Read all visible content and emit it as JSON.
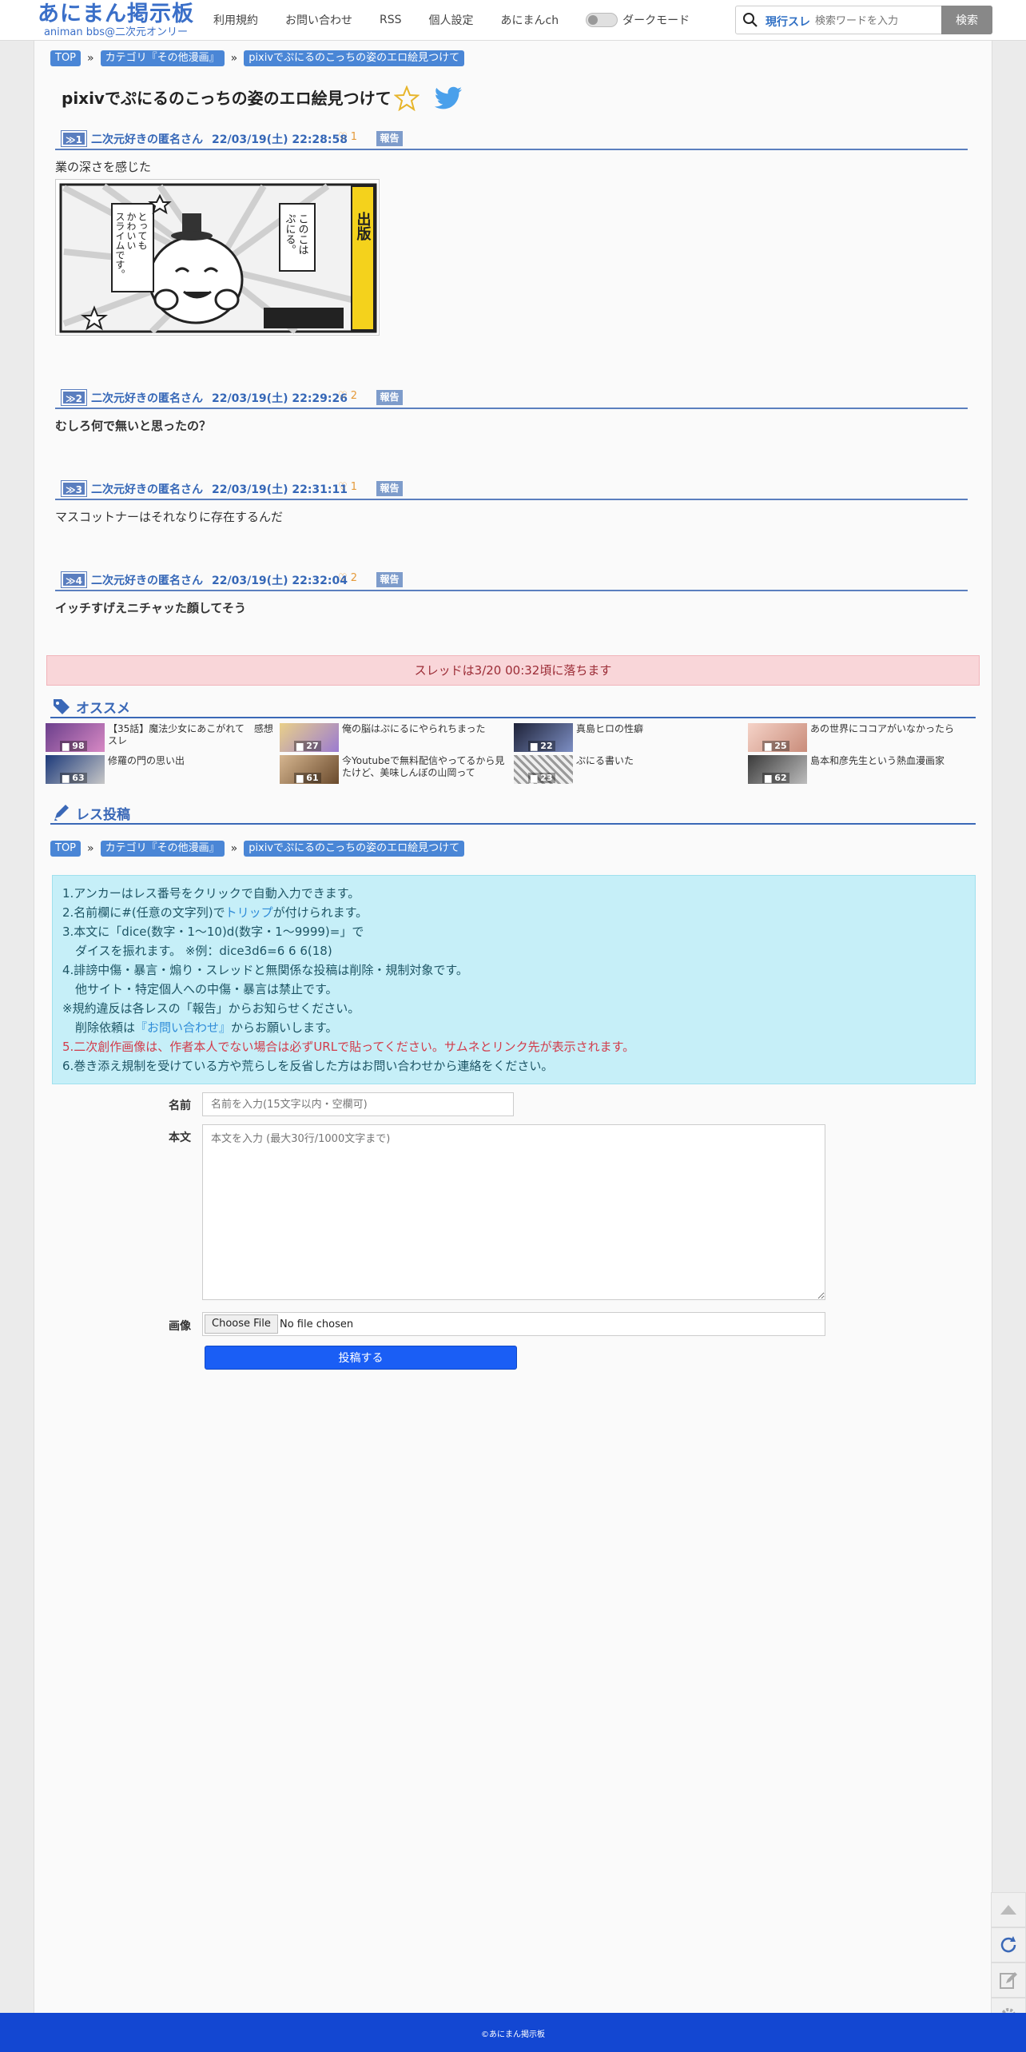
{
  "site": {
    "logo_main": "あにまん掲示板",
    "logo_sub": "animan bbs@二次元オンリー"
  },
  "nav": {
    "terms": "利用規約",
    "contact": "お問い合わせ",
    "rss": "RSS",
    "settings": "個人設定",
    "animanch": "あにまんch",
    "dark_mode": "ダークモード"
  },
  "search": {
    "scope": "現行スレ",
    "placeholder": "検索ワードを入力",
    "button": "検索"
  },
  "breadcrumb": [
    "TOP",
    "カテゴリ『その他漫画』",
    "pixivでぷにるのこっちの姿のエロ絵見つけて"
  ],
  "breadcrumb_sep": "»",
  "thread": {
    "title": "pixivでぷにるのこっちの姿のエロ絵見つけて"
  },
  "posts": [
    {
      "anchor": "≫1",
      "author": "二次元好きの匿名さん",
      "date": "22/03/19(土) 22:28:58",
      "likes": "1",
      "report": "報告",
      "body": "業の深さを感じた",
      "bold": false,
      "image_text": [
        "このこは",
        "ぷにる。",
        "とっても",
        "かわいい",
        "スライムです。",
        "出版"
      ]
    },
    {
      "anchor": "≫2",
      "author": "二次元好きの匿名さん",
      "date": "22/03/19(土) 22:29:26",
      "likes": "2",
      "report": "報告",
      "body": "むしろ何で無いと思ったの？",
      "bold": true
    },
    {
      "anchor": "≫3",
      "author": "二次元好きの匿名さん",
      "date": "22/03/19(土) 22:31:11",
      "likes": "1",
      "report": "報告",
      "body": "マスコットナーはそれなりに存在するんだ",
      "bold": false
    },
    {
      "anchor": "≫4",
      "author": "二次元好きの匿名さん",
      "date": "22/03/19(土) 22:32:04",
      "likes": "2",
      "report": "報告",
      "body": "イッチすげえニチャッた顔してそう",
      "bold": true
    }
  ],
  "drop_notice": "スレッドは3/20 00:32頃に落ちます",
  "recommend": {
    "heading": "オススメ",
    "items": [
      {
        "title": "【35話】魔法少女にあこがれて　感想スレ",
        "count": "98",
        "color": "#8a5aa8"
      },
      {
        "title": "俺の脳はぷにるにやられちまった",
        "count": "27",
        "color": "#c9a24a"
      },
      {
        "title": "真島ヒロの性癖",
        "count": "22",
        "color": "#3a4a7a"
      },
      {
        "title": "あの世界にココアがいなかったら",
        "count": "25",
        "color": "#e6b8a8"
      },
      {
        "title": "修羅の門の思い出",
        "count": "63",
        "color": "#2c4d8a"
      },
      {
        "title": "今Youtubeで無料配信やってるから見たけど、美味しんぼの山岡って",
        "count": "61",
        "color": "#b8936a"
      },
      {
        "title": "ぷにる書いた",
        "count": "23",
        "color": "#777777"
      },
      {
        "title": "島本和彦先生という熱血漫画家",
        "count": "62",
        "color": "#555555"
      }
    ]
  },
  "reply": {
    "heading": "レス投稿",
    "rules": [
      "1.アンカーはレス番号をクリックで自動入力できます。",
      "2.名前欄に#(任意の文字列)で",
      "トリップ",
      "が付けられます。",
      "3.本文に「dice(数字・1～10)d(数字・1～9999)=」で",
      "ダイスを振れます。 ※例：dice3d6=6 6 6(18)",
      "4.誹謗中傷・暴言・煽り・スレッドと無関係な投稿は削除・規制対象です。",
      "他サイト・特定個人への中傷・暴言は禁止です。",
      "※規約違反は各レスの「報告」からお知らせください。",
      "削除依頼は",
      "『お問い合わせ』",
      "からお願いします。",
      "5.二次創作画像は、作者本人でない場合は必ずURLで貼ってください。サムネとリンク先が表示されます。",
      "6.巻き添え規制を受けている方や荒らしを反省した方はお問い合わせから連絡をください。"
    ],
    "name_label": "名前",
    "name_placeholder": "名前を入力(15文字以内・空欄可)",
    "body_label": "本文",
    "body_placeholder": "本文を入力 (最大30行/1000文字まで)",
    "image_label": "画像",
    "file_button": "Choose File",
    "file_status": "No file chosen",
    "submit": "投稿する"
  },
  "footer": {
    "copyright": "©あにまん掲示板"
  },
  "colors": {
    "accent": "#3a68b7",
    "footer": "#1347d2",
    "submit": "#1a5ef5",
    "alert_bg": "#f9d6d9",
    "rules_bg": "#c6eff8"
  }
}
